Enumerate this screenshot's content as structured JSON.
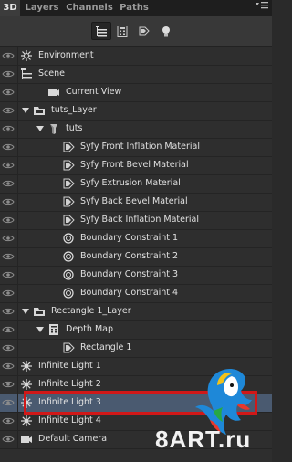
{
  "tabs": [
    {
      "label": "3D",
      "active": true
    },
    {
      "label": "Layers",
      "active": false
    },
    {
      "label": "Channels",
      "active": false
    },
    {
      "label": "Paths",
      "active": false
    }
  ],
  "panel_menu_icon": "panel-menu-icon",
  "toolbar": [
    {
      "icon": "whole-scene-icon",
      "active": true
    },
    {
      "icon": "meshes-icon",
      "active": false
    },
    {
      "icon": "materials-icon",
      "active": false
    },
    {
      "icon": "lights-icon",
      "active": false
    }
  ],
  "rows": [
    {
      "label": "Environment",
      "icon": "environment-icon",
      "indent": 0,
      "expand": null
    },
    {
      "label": "Scene",
      "icon": "scene-icon",
      "indent": 0,
      "expand": null
    },
    {
      "label": "Current View",
      "icon": "camera-icon",
      "indent": 1,
      "expand": null
    },
    {
      "label": "tuts_Layer",
      "icon": "layer-folder-icon",
      "indent": 0,
      "expand": "open"
    },
    {
      "label": "tuts",
      "icon": "mesh-icon",
      "indent": 1,
      "expand": "open"
    },
    {
      "label": "Syfy Front Inflation Material",
      "icon": "material-icon",
      "indent": 2,
      "expand": null
    },
    {
      "label": "Syfy Front Bevel Material",
      "icon": "material-icon",
      "indent": 2,
      "expand": null
    },
    {
      "label": "Syfy Extrusion Material",
      "icon": "material-icon",
      "indent": 2,
      "expand": null
    },
    {
      "label": "Syfy Back Bevel Material",
      "icon": "material-icon",
      "indent": 2,
      "expand": null
    },
    {
      "label": "Syfy Back Inflation Material",
      "icon": "material-icon",
      "indent": 2,
      "expand": null
    },
    {
      "label": "Boundary Constraint 1",
      "icon": "constraint-icon",
      "indent": 2,
      "expand": null
    },
    {
      "label": "Boundary Constraint 2",
      "icon": "constraint-icon",
      "indent": 2,
      "expand": null
    },
    {
      "label": "Boundary Constraint 3",
      "icon": "constraint-icon",
      "indent": 2,
      "expand": null
    },
    {
      "label": "Boundary Constraint 4",
      "icon": "constraint-icon",
      "indent": 2,
      "expand": null
    },
    {
      "label": "Rectangle 1_Layer",
      "icon": "layer-folder-icon",
      "indent": 0,
      "expand": "open"
    },
    {
      "label": "Depth Map",
      "icon": "depth-map-icon",
      "indent": 1,
      "expand": "open"
    },
    {
      "label": "Rectangle 1",
      "icon": "material-icon",
      "indent": 2,
      "expand": null
    },
    {
      "label": "Infinite Light 1",
      "icon": "light-icon",
      "indent": 0,
      "expand": null
    },
    {
      "label": "Infinite Light 2",
      "icon": "light-icon",
      "indent": 0,
      "expand": null
    },
    {
      "label": "Infinite Light 3",
      "icon": "light-icon",
      "indent": 0,
      "expand": null,
      "selected": true
    },
    {
      "label": "Infinite Light 4",
      "icon": "light-icon",
      "indent": 0,
      "expand": null
    },
    {
      "label": "Default Camera",
      "icon": "camera-icon",
      "indent": 0,
      "expand": null
    }
  ],
  "watermark": {
    "text": "8ART",
    "dot": ".",
    "tld": "ru"
  },
  "colors": {
    "selected_row": "#4a5a70",
    "highlight_box": "#d01818",
    "panel_bg": "#2e2e2e"
  }
}
